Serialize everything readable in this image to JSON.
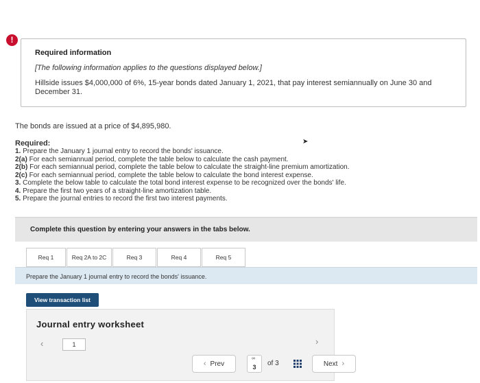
{
  "alert": {
    "glyph": "!"
  },
  "info": {
    "title": "Required information",
    "note": "[The following information applies to the questions displayed below.]",
    "body": "Hillside issues $4,000,000 of 6%, 15-year bonds dated January 1, 2021, that pay interest semiannually on June 30 and December 31."
  },
  "issued_text": "The bonds are issued at a price of $4,895,980.",
  "required": {
    "heading": "Required:",
    "items": [
      {
        "num": "1.",
        "text": "Prepare the January 1 journal entry to record the bonds' issuance."
      },
      {
        "num": "2(a)",
        "text": "For each semiannual period, complete the table below to calculate the cash payment."
      },
      {
        "num": "2(b)",
        "text": "For each semiannual period, complete the table below to calculate the straight-line premium amortization."
      },
      {
        "num": "2(c)",
        "text": "For each semiannual period, complete the table below to calculate the bond interest expense."
      },
      {
        "num": "3.",
        "text": "Complete the below table to calculate the total bond interest expense to be recognized over the bonds' life."
      },
      {
        "num": "4.",
        "text": "Prepare the first two years of a straight-line amortization table."
      },
      {
        "num": "5.",
        "text": "Prepare the journal entries to record the first two interest payments."
      }
    ]
  },
  "complete_text": "Complete this question by entering your answers in the tabs below.",
  "tabs": [
    {
      "label": "Req 1",
      "width": 58
    },
    {
      "label": "Req 2A to 2C",
      "width": 66
    },
    {
      "label": "Req 3",
      "width": 64
    },
    {
      "label": "Req 4",
      "width": 64
    },
    {
      "label": "Req 5",
      "width": 64
    }
  ],
  "prompt": "Prepare the January 1 journal entry to record the bonds' issuance.",
  "view_button": "View transaction list",
  "worksheet": {
    "title": "Journal entry worksheet",
    "page": "1"
  },
  "nav": {
    "prev": "Prev",
    "page": "3",
    "of": "of 3",
    "next": "Next"
  }
}
